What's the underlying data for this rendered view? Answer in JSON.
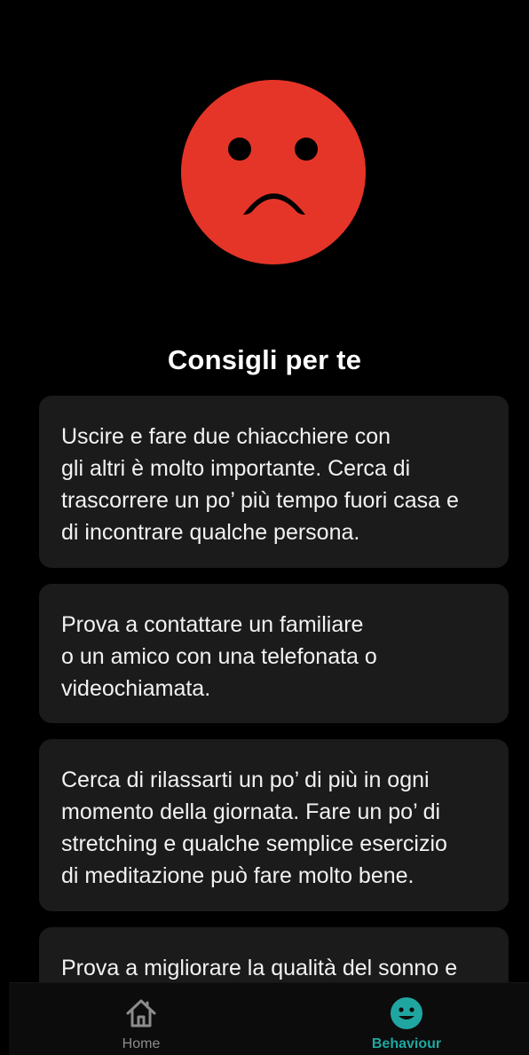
{
  "mood": {
    "icon": "sad-face-icon",
    "color": "#e53528"
  },
  "section": {
    "title": "Consigli per te"
  },
  "tips": [
    {
      "text": "Uscire e fare due chiacchiere con\ngli altri è molto importante. Cerca di\ntrascorrere un po’ più tempo fuori casa e\ndi incontrare qualche persona."
    },
    {
      "text": "Prova a contattare un familiare\no un amico con una telefonata o\nvideochiamata."
    },
    {
      "text": "Cerca di rilassarti un po’ di più in ogni\nmomento della giornata. Fare un po’ di\nstretching e qualche semplice esercizio\ndi meditazione può fare molto bene."
    },
    {
      "text": "Prova a migliorare la qualità del sonno e"
    }
  ],
  "bottom_nav": {
    "items": [
      {
        "label": "Home",
        "icon": "home-icon",
        "active": false
      },
      {
        "label": "Behaviour",
        "icon": "smiley-icon",
        "active": true
      }
    ],
    "active_color": "#20a6a0",
    "inactive_color": "#8c8c8c"
  }
}
